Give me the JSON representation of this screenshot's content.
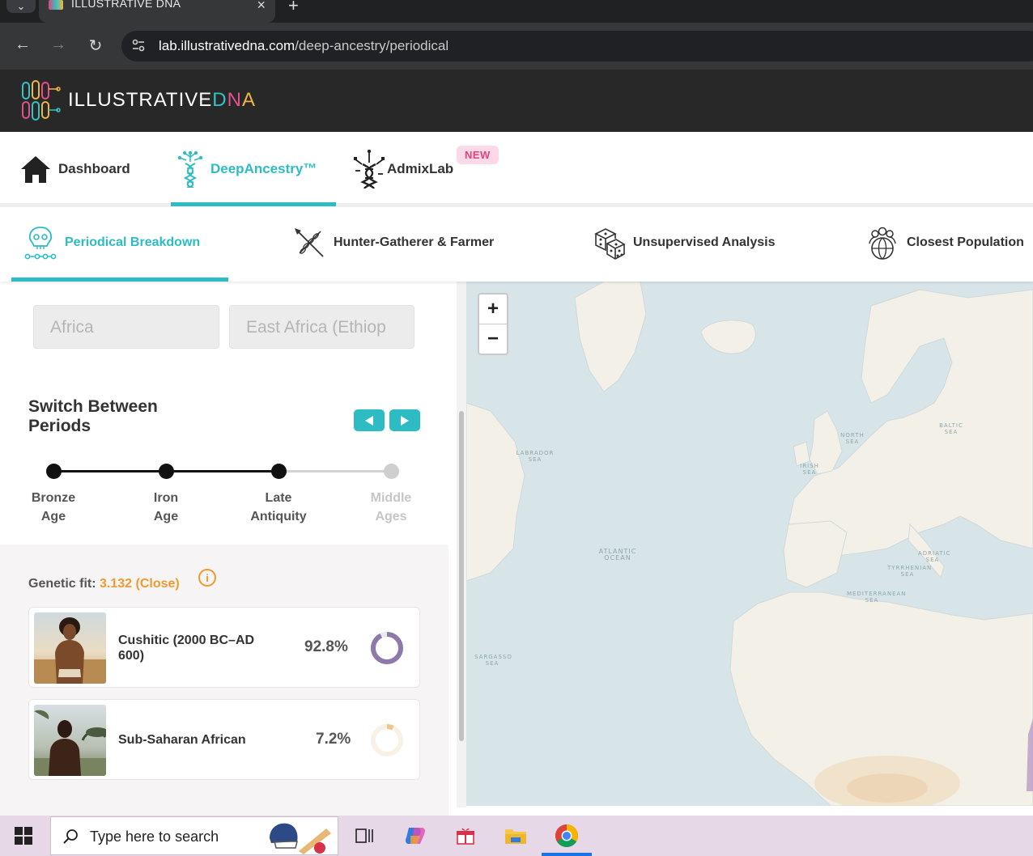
{
  "browser": {
    "tab_title": "ILLUSTRATIVE DNA",
    "url_host": "lab.illustrativedna.com",
    "url_path": "/deep-ancestry/periodical"
  },
  "site": {
    "logo_text_prefix": "ILLUSTRATIVE",
    "logo_text_d": "D",
    "logo_text_n": "N",
    "logo_text_a": "A"
  },
  "main_nav": {
    "dashboard": "Dashboard",
    "deep_ancestry": "DeepAncestry™",
    "admixlab": "AdmixLab",
    "new_badge": "NEW"
  },
  "sub_nav": {
    "periodical": "Periodical Breakdown",
    "hunter": "Hunter-Gatherer & Farmer",
    "unsupervised": "Unsupervised Analysis",
    "closest": "Closest Population"
  },
  "filters": {
    "region": "Africa",
    "subregion": "East Africa (Ethiop"
  },
  "periods": {
    "title": "Switch Between Periods",
    "items": [
      {
        "line1": "Bronze",
        "line2": "Age"
      },
      {
        "line1": "Iron",
        "line2": "Age"
      },
      {
        "line1": "Late",
        "line2": "Antiquity"
      },
      {
        "line1": "Middle",
        "line2": "Ages"
      }
    ]
  },
  "results": {
    "fit_label": "Genetic fit:",
    "fit_value": "3.132 (Close)",
    "info_icon": "i",
    "items": [
      {
        "name": "Cushitic (2000 BC–AD 600)",
        "pct": "92.8%",
        "share": 0.928,
        "color": "#8e79ab"
      },
      {
        "name": "Sub-Saharan African",
        "pct": "7.2%",
        "share": 0.072,
        "color": "#f0c58a"
      }
    ]
  },
  "map": {
    "zoom_in": "+",
    "zoom_out": "−",
    "labels": {
      "labrador": "LABRADOR SEA",
      "atlantic": "ATLANTIC OCEAN",
      "north_sea": "NORTH SEA",
      "irish_sea": "IRISH SEA",
      "baltic": "BALTIC SEA",
      "adriatic": "ADRIATIC SEA",
      "tyrrhenian": "TYRRHENIAN SEA",
      "mediterranean": "MEDITERRANEAN SEA",
      "sargasso": "SARGASSO SEA"
    }
  },
  "taskbar": {
    "search_placeholder": "Type here to search"
  }
}
